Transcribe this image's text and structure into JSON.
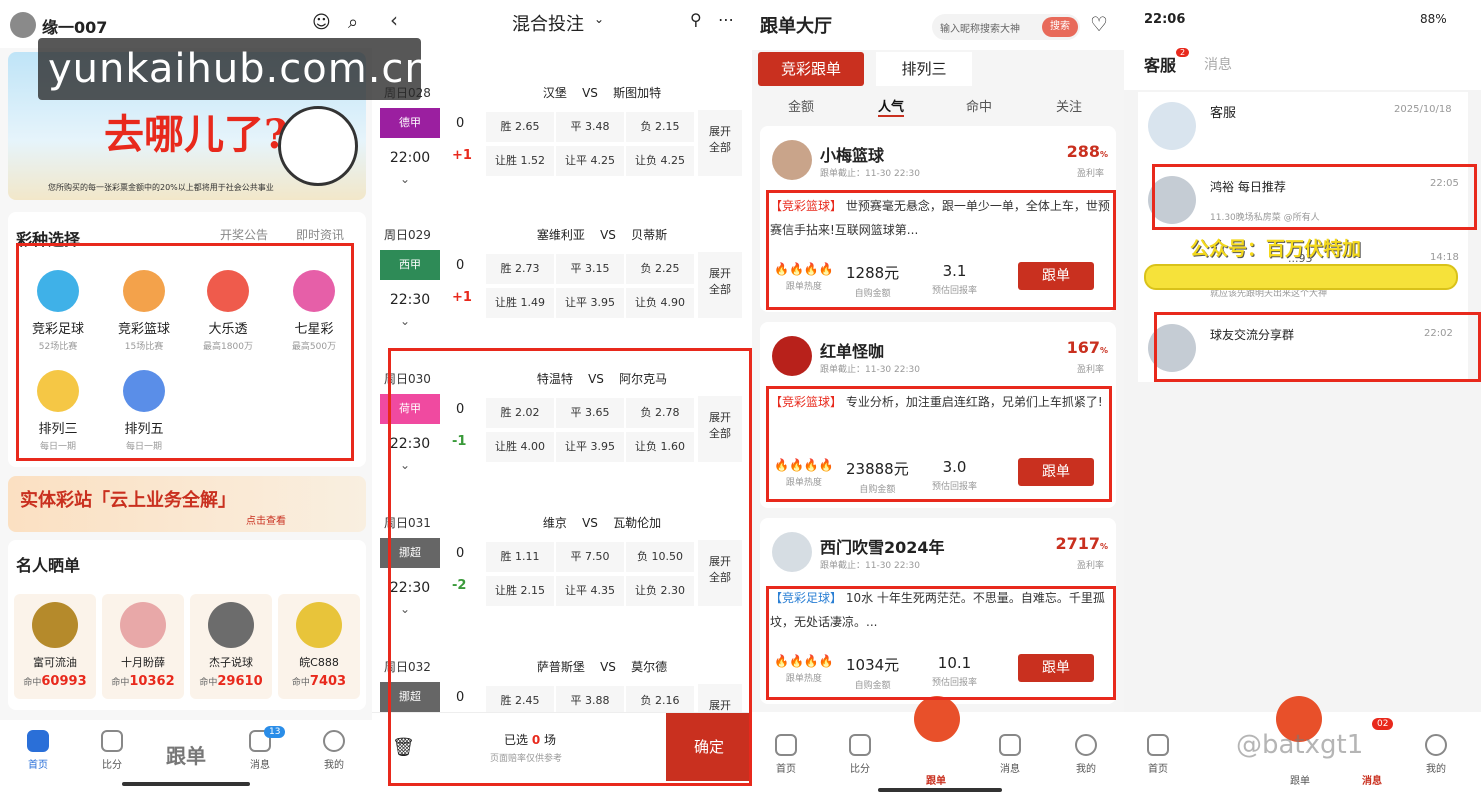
{
  "watermark": "yunkaihub.com.cn",
  "p1": {
    "username": "缘一007",
    "banner_title": "去哪儿了?",
    "banner_note": "您所购买的每一张彩票金额中的20%以上都将用于社会公共事业",
    "section_title": "彩种选择",
    "link1": "开奖公告",
    "link2": "即时资讯",
    "lotteries": [
      {
        "name": "竞彩足球",
        "sub": "52场比赛",
        "color": "#3fb1e8"
      },
      {
        "name": "竞彩篮球",
        "sub": "15场比赛",
        "color": "#f3a24b"
      },
      {
        "name": "大乐透",
        "sub": "最高1800万",
        "color": "#ef5b4c"
      },
      {
        "name": "七星彩",
        "sub": "最高500万",
        "color": "#e65fa8"
      },
      {
        "name": "排列三",
        "sub": "每日一期",
        "color": "#f5c745"
      },
      {
        "name": "排列五",
        "sub": "每日一期",
        "color": "#5a8ee8"
      }
    ],
    "promo": "实体彩站「云上业务全解」",
    "promo_link": "点击查看",
    "stars_title": "名人晒单",
    "stars": [
      {
        "name": "富可流油",
        "hit_label": "命中",
        "hit": "60993"
      },
      {
        "name": "十月盼薛",
        "hit_label": "命中",
        "hit": "10362"
      },
      {
        "name": "杰子说球",
        "hit_label": "命中",
        "hit": "29610"
      },
      {
        "name": "皖C888",
        "hit_label": "命中",
        "hit": "7403"
      }
    ],
    "tabs": [
      "首页",
      "比分",
      "跟单",
      "消息",
      "我的"
    ],
    "badge": "13"
  },
  "p2": {
    "title": "混合投注",
    "matches": [
      {
        "date": "周日028",
        "teams": "汉堡    VS    斯图加特",
        "league": "德甲",
        "league_color": "#9b1fa0",
        "time": "22:00",
        "h1": "+1",
        "h1_color": "#e8291c",
        "odds": [
          "胜 2.65",
          "平 3.48",
          "负 2.15",
          "让胜 1.52",
          "让平 4.25",
          "让负 4.25"
        ]
      },
      {
        "date": "周日029",
        "teams": "塞维利亚    VS    贝蒂斯",
        "league": "西甲",
        "league_color": "#2e8b57",
        "time": "22:30",
        "h1": "+1",
        "h1_color": "#e8291c",
        "odds": [
          "胜 2.73",
          "平 3.15",
          "负 2.25",
          "让胜 1.49",
          "让平 3.95",
          "让负 4.90"
        ]
      },
      {
        "date": "周日030",
        "teams": "特温特    VS    阿尔克马",
        "league": "荷甲",
        "league_color": "#f04aa0",
        "time": "22:30",
        "h1": "-1",
        "h1_color": "#3a9a3a",
        "odds": [
          "胜 2.02",
          "平 3.65",
          "负 2.78",
          "让胜 4.00",
          "让平 3.95",
          "让负 1.60"
        ]
      },
      {
        "date": "周日031",
        "teams": "维京    VS    瓦勒伦加",
        "league": "挪超",
        "league_color": "#666666",
        "time": "22:30",
        "h1": "-2",
        "h1_color": "#3a9a3a",
        "odds": [
          "胜 1.11",
          "平 7.50",
          "负 10.50",
          "让胜 2.15",
          "让平 4.35",
          "让负 2.30"
        ]
      },
      {
        "date": "周日032",
        "teams": "萨普斯堡    VS    莫尔德",
        "league": "挪超",
        "league_color": "#666666",
        "time": "",
        "h1": "",
        "h1_color": "#3a9a3a",
        "odds": [
          "胜 2.45",
          "平 3.88",
          "负 2.16",
          "",
          "",
          ""
        ]
      }
    ],
    "expand": "展开\n全部",
    "selected_prefix": "已选",
    "selected_count": "0",
    "selected_suffix": "场",
    "note": "页面赔率仅供参考",
    "confirm": "确定"
  },
  "p3": {
    "title": "跟单大厅",
    "search_placeholder": "输入昵称搜索大神",
    "search_btn": "搜索",
    "tab1": "竞彩跟单",
    "tab2": "排列三",
    "subtabs": [
      "金额",
      "人气",
      "命中",
      "关注"
    ],
    "tipsters": [
      {
        "name": "小梅篮球",
        "deadline": "跟单截止：11-30 22:30",
        "rate": "288",
        "rate_unit": "%",
        "rate_label": "盈利率",
        "tag": "【竞彩篮球】",
        "text": "世预赛毫无悬念，跟一单少一单，全体上车，世预赛信手拈来!互联网篮球第...",
        "amount": "1288元",
        "amount_label": "自购金额",
        "ret": "3.1",
        "ret_label": "预估回报率",
        "heat_label": "跟单热度",
        "tag_color": "#e8291c",
        "avatar": "#c9a48a"
      },
      {
        "name": "红单怪咖",
        "deadline": "跟单截止：11-30 22:30",
        "rate": "167",
        "rate_unit": "%",
        "rate_label": "盈利率",
        "tag": "【竞彩篮球】",
        "text": "专业分析，加注重启连红路，兄弟们上车抓紧了!",
        "amount": "23888元",
        "amount_label": "自购金额",
        "ret": "3.0",
        "ret_label": "预估回报率",
        "heat_label": "跟单热度",
        "tag_color": "#e8291c",
        "avatar": "#b8211b"
      },
      {
        "name": "西门吹雪2024年",
        "deadline": "跟单截止：11-30 22:30",
        "rate": "2717",
        "rate_unit": "%",
        "rate_label": "盈利率",
        "tag": "【竞彩足球】",
        "text": "10水 十年生死两茫茫。不思量。自难忘。千里孤坟，无处话凄凉。...",
        "amount": "1034元",
        "amount_label": "自购金额",
        "ret": "10.1",
        "ret_label": "预估回报率",
        "heat_label": "跟单热度",
        "tag_color": "#2a7fd4",
        "avatar": "#d6dde3"
      }
    ],
    "follow": "跟单",
    "tabs": [
      "首页",
      "比分",
      "跟单",
      "消息",
      "我的"
    ]
  },
  "p4": {
    "time": "22:06",
    "status": "88%",
    "tab1": "客服",
    "tab1_badge": "2",
    "tab2": "消息",
    "messages": [
      {
        "title": "客服",
        "sub": "",
        "time": "2025/10/18",
        "badge": ""
      },
      {
        "title": "鸿裕 每日推荐",
        "sub": "11.30晚场私房菜 @所有人",
        "time": "22:05",
        "badge": "!"
      },
      {
        "title": "...93",
        "sub": "就应该先跟明天出来这个大神",
        "time": "14:18",
        "badge": ""
      },
      {
        "title": "球友交流分享群",
        "sub": "",
        "time": "22:02",
        "badge": "!"
      }
    ],
    "overlay": "公众号：百万伏特加",
    "handle": "@batxgt1",
    "tabs": [
      "首页",
      "",
      "跟单",
      "消息",
      "我的"
    ],
    "msg_badge": "02"
  }
}
